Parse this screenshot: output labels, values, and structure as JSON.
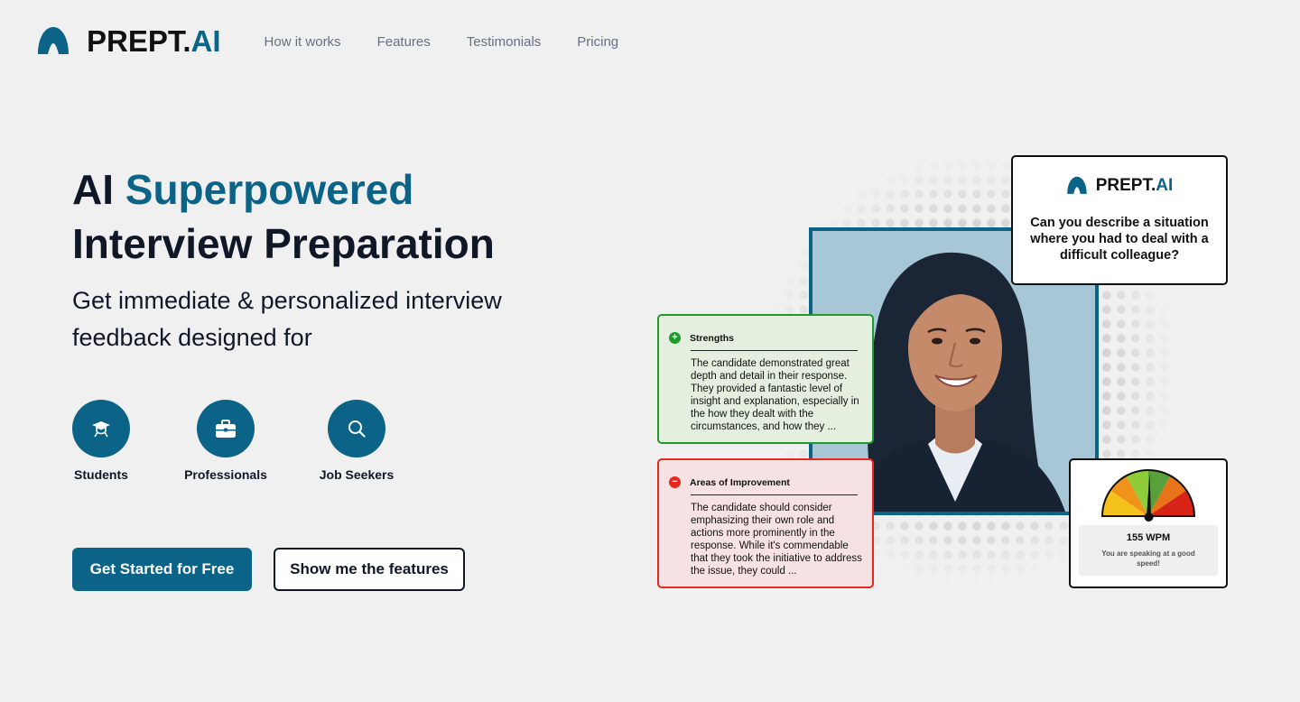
{
  "brand": {
    "name_main": "PREPT.",
    "name_accent": "AI",
    "accent_color": "#0b6388"
  },
  "nav": {
    "links": [
      {
        "label": "How it works"
      },
      {
        "label": "Features"
      },
      {
        "label": "Testimonials"
      },
      {
        "label": "Pricing"
      }
    ]
  },
  "hero": {
    "title_prefix": "AI ",
    "title_accent": "Superpowered",
    "title_line2": "Interview Preparation",
    "subtitle": "Get immediate & personalized interview feedback designed for",
    "personas": [
      {
        "label": "Students",
        "icon": "graduation-cap-icon"
      },
      {
        "label": "Professionals",
        "icon": "briefcase-icon"
      },
      {
        "label": "Job Seekers",
        "icon": "magnifier-icon"
      }
    ],
    "cta_primary": "Get Started for Free",
    "cta_secondary": "Show me the features"
  },
  "illustration": {
    "question_card": {
      "brand_main": "PREPT.",
      "brand_accent": "AI",
      "question": "Can you describe a situation where you had to deal with a difficult colleague?"
    },
    "strengths": {
      "icon": "+",
      "title": "Strengths",
      "body": "The candidate demonstrated great depth and detail in their response. They provided a fantastic level of insight and explanation, especially in the how they dealt with the circumstances, and how they ...",
      "color": "#1f9a2b"
    },
    "improvement": {
      "icon": "−",
      "title": "Areas of Improvement",
      "body": "The candidate should consider emphasizing their own role and actions more prominently in the response. While it's commendable that they took the initiative to address the issue, they could ...",
      "color": "#e8271f"
    },
    "speed": {
      "value": "155 WPM",
      "message": "You are speaking at a good speed!"
    }
  }
}
